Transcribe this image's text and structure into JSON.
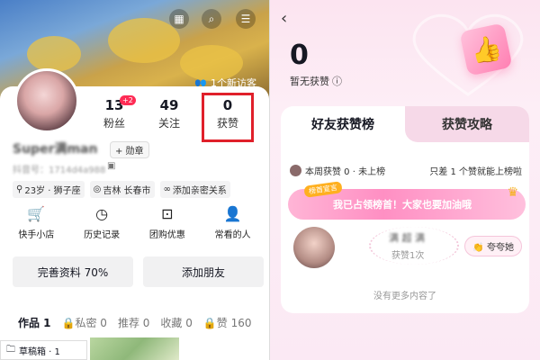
{
  "profile": {
    "visitor_text": "1个新访客",
    "stats": [
      {
        "num": "13",
        "label": "粉丝"
      },
      {
        "num": "49",
        "label": "关注"
      },
      {
        "num": "0",
        "label": "获赞"
      }
    ],
    "fans_badge": "+2",
    "username": "Super满man",
    "medal_label": "+ 勋章",
    "uid": "抖音号：1714d4a988",
    "tags": [
      "23岁 · 狮子座",
      "吉林 长春市",
      "添加亲密关系"
    ],
    "services": [
      {
        "icon": "cart-icon",
        "label": "快手小店"
      },
      {
        "icon": "clock-icon",
        "label": "历史记录"
      },
      {
        "icon": "coupon-icon",
        "label": "团购优惠"
      },
      {
        "icon": "person-icon",
        "label": "常看的人"
      }
    ],
    "buttons": {
      "complete": "完善资料 70%",
      "add_friend": "添加朋友"
    },
    "tabs": [
      {
        "label": "作品 1"
      },
      {
        "label": "私密 0"
      },
      {
        "label": "推荐 0"
      },
      {
        "label": "收藏 0"
      },
      {
        "label": "赞 160"
      }
    ],
    "drafts": "草稿箱 · 1"
  },
  "likes_page": {
    "count": "0",
    "no_likes_text": "暂无获赞",
    "tab_friends": "好友获赞榜",
    "tab_strategy": "获赞攻略",
    "week_text": "本周获赞 0 · 未上榜",
    "week_hint": "只差 1 个赞就能上榜啦",
    "stamp": "榜首宣言",
    "banner_text": "我已占领榜首！大家也要加油哦",
    "entry_name": "满 超 满",
    "entry_sub": "获赞1次",
    "praise_button": "夸夸她",
    "no_more": "没有更多内容了"
  },
  "colors": {
    "highlight_border": "#e0202a",
    "badge": "#fe2c55",
    "accent_pink": "#ff8fc3"
  }
}
